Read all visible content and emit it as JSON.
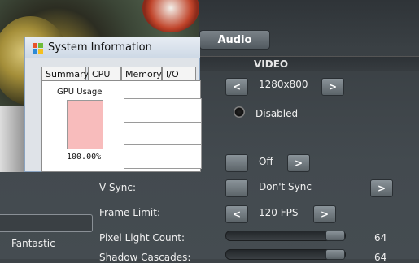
{
  "window": {
    "title": "System Information",
    "tabs": [
      "Summary",
      "CPU",
      "Memory",
      "I/O"
    ],
    "gpu_usage_label": "GPU Usage",
    "gpu_usage_value": "100.00%"
  },
  "settings": {
    "audio_button": "Audio",
    "video_header": "VIDEO",
    "resolution": "1280x800",
    "fullscreen_state": "Disabled",
    "aa_value": "Off",
    "vsync_label": "V Sync:",
    "vsync_value": "Don't Sync",
    "frame_limit_label": "Frame Limit:",
    "frame_limit_value": "120 FPS",
    "pixel_light_label": "Pixel Light Count:",
    "pixel_light_value": "64",
    "shadow_label": "Shadow Cascades:",
    "shadow_value": "64",
    "quality_value": "Fantastic",
    "arrow_left": "<",
    "arrow_right": ">"
  },
  "colors": {
    "gpu_fill": "#f8bcbc",
    "panel_bg": "#3e4448"
  }
}
